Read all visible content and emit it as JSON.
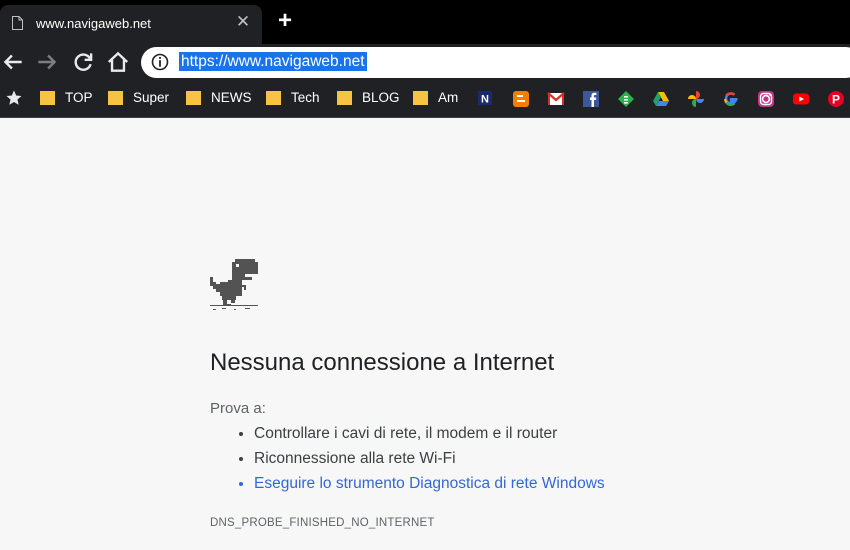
{
  "tab": {
    "title": "www.navigaweb.net",
    "close_icon": "close-icon",
    "new_tab_icon": "plus-icon"
  },
  "toolbar": {
    "url": "https://www.navigaweb.net",
    "back_icon": "back-arrow-icon",
    "forward_icon": "forward-arrow-icon",
    "reload_icon": "reload-icon",
    "home_icon": "home-icon",
    "info_icon": "info-icon"
  },
  "bookmarks": {
    "folders": [
      {
        "label": "TOP"
      },
      {
        "label": "Super"
      },
      {
        "label": "NEWS"
      },
      {
        "label": "Tech"
      },
      {
        "label": "BLOG"
      },
      {
        "label": "Am"
      }
    ],
    "icons": [
      "navigaweb-icon",
      "blogger-icon",
      "gmail-icon",
      "facebook-icon",
      "feedly-icon",
      "google-drive-icon",
      "google-photos-icon",
      "google-icon",
      "instagram-icon",
      "youtube-icon",
      "pinterest-icon"
    ],
    "colors": {
      "folder": "#f6c343",
      "blogger": "#f57d00",
      "facebook": "#3b5998",
      "feedly": "#2bb24c",
      "youtube": "#ff0000",
      "pinterest": "#e60023",
      "instagram": "#c13584"
    }
  },
  "error": {
    "heading": "Nessuna connessione a Internet",
    "intro": "Prova a:",
    "suggestions": [
      "Controllare i cavi di rete, il modem e il router",
      "Riconnessione alla rete Wi-Fi",
      "Eseguire lo strumento Diagnostica di rete Windows"
    ],
    "code": "DNS_PROBE_FINISHED_NO_INTERNET",
    "link_color": "#3367d6"
  }
}
